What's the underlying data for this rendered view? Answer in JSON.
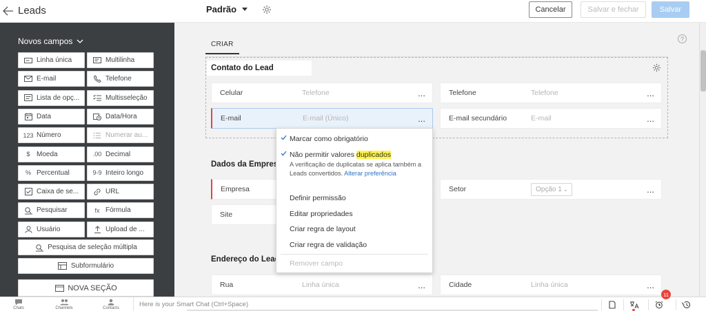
{
  "header": {
    "title": "Leads",
    "layout_name": "Padrão",
    "cancel": "Cancelar",
    "save_close": "Salvar e fechar",
    "save": "Salvar"
  },
  "palette": {
    "heading": "Novos campos",
    "tiles": [
      {
        "label": "Linha única",
        "icon": "single-line-icon"
      },
      {
        "label": "Multilinha",
        "icon": "multi-line-icon"
      },
      {
        "label": "E-mail",
        "icon": "email-icon"
      },
      {
        "label": "Telefone",
        "icon": "phone-icon"
      },
      {
        "label": "Lista de opç...",
        "icon": "picklist-icon"
      },
      {
        "label": "Multisseleção",
        "icon": "multiselect-icon"
      },
      {
        "label": "Data",
        "icon": "calendar-icon"
      },
      {
        "label": "Data/Hora",
        "icon": "datetime-icon"
      },
      {
        "label": "Número",
        "icon": "number-icon",
        "glyph": "123"
      },
      {
        "label": "Numerar au...",
        "icon": "auto-number-icon",
        "dim": true
      },
      {
        "label": "Moeda",
        "icon": "currency-icon",
        "glyph": "$"
      },
      {
        "label": "Decimal",
        "icon": "decimal-icon",
        "glyph": ".00"
      },
      {
        "label": "Percentual",
        "icon": "percent-icon",
        "glyph": "%"
      },
      {
        "label": "Inteiro longo",
        "icon": "long-integer-icon",
        "glyph": "9-9"
      },
      {
        "label": "Caixa de se...",
        "icon": "checkbox-icon"
      },
      {
        "label": "URL",
        "icon": "link-icon"
      },
      {
        "label": "Pesquisar",
        "icon": "lookup-icon"
      },
      {
        "label": "Fórmula",
        "icon": "formula-icon",
        "glyph": "fx"
      },
      {
        "label": "Usuário",
        "icon": "user-icon"
      },
      {
        "label": "Upload de ...",
        "icon": "upload-icon"
      }
    ],
    "multi_lookup": "Pesquisa de seleção múltipla",
    "subform": "Subformulário",
    "new_section": "NOVA SEÇÃO"
  },
  "canvas": {
    "help": "?",
    "tab": "CRIAR",
    "sections": {
      "contact": "Contato do Lead",
      "company": "Dados da Empres",
      "address": "Endereço do Lead"
    },
    "fields": {
      "celular": {
        "label": "Celular",
        "placeholder": "Telefone"
      },
      "telefone": {
        "label": "Telefone",
        "placeholder": "Telefone"
      },
      "email": {
        "label": "E-mail",
        "placeholder": "E-mail (Único)"
      },
      "email2": {
        "label": "E-mail secundário",
        "placeholder": "E-mail"
      },
      "empresa": {
        "label": "Empresa"
      },
      "setor": {
        "label": "Setor",
        "value": "Opção 1"
      },
      "site": {
        "label": "Site"
      },
      "rua": {
        "label": "Rua",
        "placeholder": "Linha única"
      },
      "cidade": {
        "label": "Cidade",
        "placeholder": "Linha única"
      },
      "dots": "..."
    }
  },
  "menu": {
    "mandatory": "Marcar como obrigatório",
    "no_dup_prefix": "Não permitir valores ",
    "no_dup_highlight": "duplicados",
    "desc": "A verificação de duplicatas se aplica também a Leads convertidos.",
    "desc_link": "Alterar preferência",
    "permission": "Definir permissão",
    "edit_props": "Editar propriedades",
    "layout_rule": "Criar regra de layout",
    "validation_rule": "Criar regra de validação",
    "remove": "Remover campo"
  },
  "bottom": {
    "chats": "Chats",
    "channels": "Channels",
    "contacts": "Contacts",
    "chat_placeholder": "Here is your Smart Chat (Ctrl+Space)",
    "badge": "11"
  },
  "colors": {
    "accent": "#2a72c9",
    "save_disabled": "#a9cdf2",
    "mandatory": "#e04444",
    "highlight": "#fff34d",
    "palette_bg": "#3c3f42"
  }
}
